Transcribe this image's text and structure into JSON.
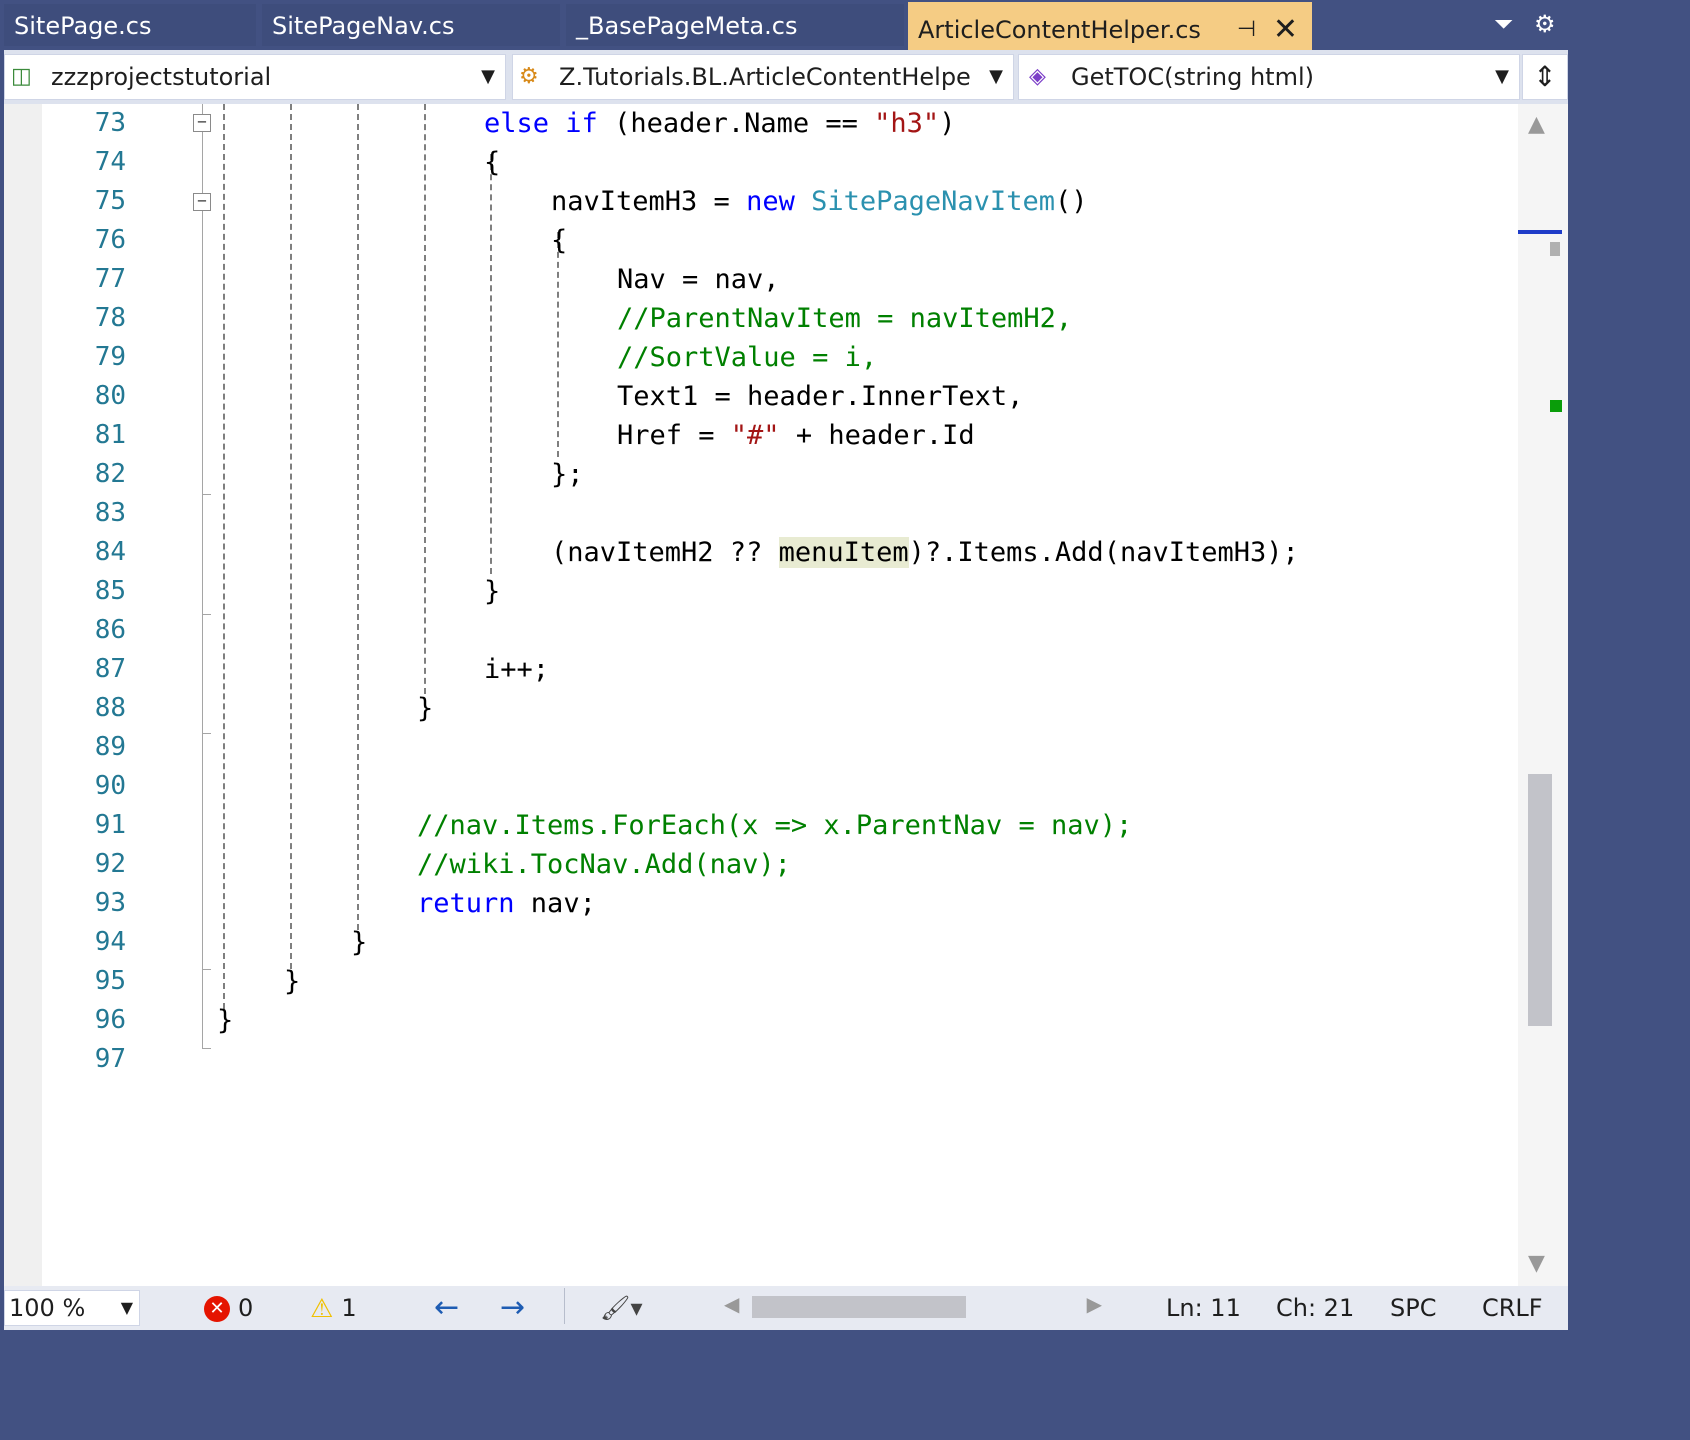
{
  "tabs": [
    {
      "label": "SitePage.cs"
    },
    {
      "label": "SitePageNav.cs"
    },
    {
      "label": "_BasePageMeta.cs"
    },
    {
      "label": "ArticleContentHelper.cs",
      "active": true
    }
  ],
  "navbar": {
    "project": "zzzprojectstutorial",
    "type": "Z.Tutorials.BL.ArticleContentHelpe",
    "member": "GetTOC(string html)"
  },
  "line_numbers": [
    "73",
    "74",
    "75",
    "76",
    "77",
    "78",
    "79",
    "80",
    "81",
    "82",
    "83",
    "84",
    "85",
    "86",
    "87",
    "88",
    "89",
    "90",
    "91",
    "92",
    "93",
    "94",
    "95",
    "96",
    "97"
  ],
  "code": {
    "l73": {
      "kw1": "else",
      "kw2": "if",
      "a": " (header.Name == ",
      "str": "\"h3\"",
      "b": ")"
    },
    "l74": "{",
    "l75": {
      "a": "navItemH3 = ",
      "kw": "new",
      "ty": "SitePageNavItem",
      "b": "()"
    },
    "l76": "{",
    "l77": "Nav = nav,",
    "l78": "//ParentNavItem = navItemH2,",
    "l79": "//SortValue = i,",
    "l80": "Text1 = header.InnerText,",
    "l81": {
      "a": "Href = ",
      "str": "\"#\"",
      "b": " + header.Id"
    },
    "l82": "};",
    "l84": {
      "a": "(navItemH2 ?? ",
      "hl": "menuItem",
      "b": ")?.Items.Add(navItemH3);"
    },
    "l85": "}",
    "l87": "i++;",
    "l88": "}",
    "l91": "//nav.Items.ForEach(x => x.ParentNav = nav);",
    "l92": "//wiki.TocNav.Add(nav);",
    "l93": {
      "kw": "return",
      "a": " nav;"
    },
    "l94": "}",
    "l95": "}",
    "l96": "}"
  },
  "status": {
    "zoom": "100 %",
    "errors": "0",
    "warnings": "1",
    "ln": "Ln: 11",
    "ch": "Ch: 21",
    "spc": "SPC",
    "crlf": "CRLF"
  },
  "colors": {
    "keyword": "#0000ff",
    "type": "#2b91af",
    "string": "#a31515",
    "comment": "#008000",
    "line_number": "#237893",
    "active_tab": "#f5cc84",
    "chrome": "#425182"
  },
  "icons": [
    "pin-icon",
    "close-icon",
    "dropdown-icon",
    "settings-icon",
    "project-icon",
    "class-icon",
    "method-icon",
    "split-icon",
    "error-icon",
    "warning-icon",
    "back-icon",
    "forward-icon",
    "cleanup-icon"
  ]
}
